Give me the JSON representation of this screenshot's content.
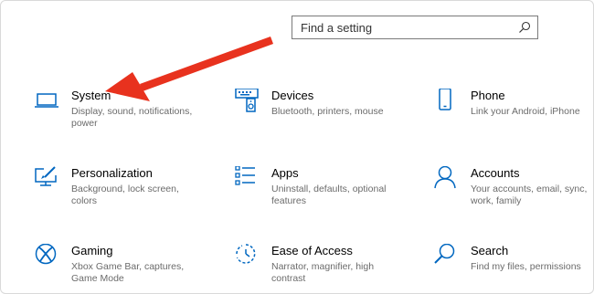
{
  "search": {
    "placeholder": "Find a setting",
    "icon": "search-icon"
  },
  "accent": "#0067c0",
  "annotation_color": "#e8321e",
  "tiles": [
    {
      "id": "system",
      "icon": "monitor-icon",
      "title": "System",
      "desc": "Display, sound, notifications, power"
    },
    {
      "id": "devices",
      "icon": "keyboard-speaker-icon",
      "title": "Devices",
      "desc": "Bluetooth, printers, mouse"
    },
    {
      "id": "phone",
      "icon": "phone-icon",
      "title": "Phone",
      "desc": "Link your Android, iPhone"
    },
    {
      "id": "personalization",
      "icon": "paint-monitor-icon",
      "title": "Personalization",
      "desc": "Background, lock screen, colors"
    },
    {
      "id": "apps",
      "icon": "apps-list-icon",
      "title": "Apps",
      "desc": "Uninstall, defaults, optional features"
    },
    {
      "id": "accounts",
      "icon": "person-icon",
      "title": "Accounts",
      "desc": "Your accounts, email, sync, work, family"
    },
    {
      "id": "gaming",
      "icon": "xbox-icon",
      "title": "Gaming",
      "desc": "Xbox Game Bar, captures, Game Mode"
    },
    {
      "id": "ease",
      "icon": "ease-of-access-icon",
      "title": "Ease of Access",
      "desc": "Narrator, magnifier, high contrast"
    },
    {
      "id": "search",
      "icon": "search-icon",
      "title": "Search",
      "desc": "Find my files, permissions"
    }
  ]
}
